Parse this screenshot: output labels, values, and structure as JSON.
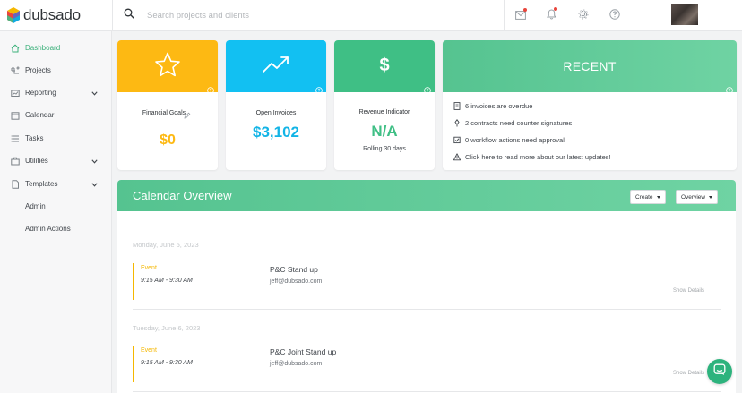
{
  "app": {
    "brand": "dubsado"
  },
  "search": {
    "placeholder": "Search projects and clients"
  },
  "sidebar": {
    "items": [
      {
        "label": "Dashboard",
        "icon": "home-icon"
      },
      {
        "label": "Projects",
        "icon": "projects-icon"
      },
      {
        "label": "Reporting",
        "icon": "chart-icon"
      },
      {
        "label": "Calendar",
        "icon": "calendar-icon"
      },
      {
        "label": "Tasks",
        "icon": "tasks-icon"
      },
      {
        "label": "Utilities",
        "icon": "briefcase-icon"
      },
      {
        "label": "Templates",
        "icon": "document-icon"
      },
      {
        "label": "Admin"
      },
      {
        "label": "Admin Actions"
      }
    ]
  },
  "cards": {
    "financial": {
      "title": "Financial Goals",
      "value": "$0",
      "color": "#fdb913"
    },
    "invoices": {
      "title": "Open Invoices",
      "value": "$3,102",
      "color": "#12c0f2"
    },
    "revenue": {
      "title": "Revenue Indicator",
      "value": "N/A",
      "sub": "Rolling 30 days",
      "color": "#3fbf85"
    }
  },
  "recent": {
    "title": "RECENT",
    "items": [
      {
        "text": "6 invoices are overdue",
        "icon": "invoice-icon"
      },
      {
        "text": "2 contracts need counter signatures",
        "icon": "pen-icon"
      },
      {
        "text": "0 workflow actions need approval",
        "icon": "checkbox-icon"
      },
      {
        "text": "Click here to read more about our latest updates!",
        "icon": "warning-icon"
      }
    ]
  },
  "calendar": {
    "title": "Calendar Overview",
    "create_label": "Create",
    "overview_label": "Overview",
    "days": [
      {
        "date": "Monday, June 5, 2023",
        "event": {
          "type": "Event",
          "time": "9:15 AM - 9:30 AM",
          "name": "P&C Stand up",
          "email": "jeff@dubsado.com",
          "details": "Show Details"
        }
      },
      {
        "date": "Tuesday, June 6, 2023",
        "event": {
          "type": "Event",
          "time": "9:15 AM - 9:30 AM",
          "name": "P&C Joint Stand up",
          "email": "jeff@dubsado.com",
          "details": "Show Details"
        }
      }
    ]
  },
  "colors": {
    "accent": "#3fbf85",
    "warning": "#fdb913",
    "info": "#12c0f2",
    "notification": "#e8453c"
  }
}
